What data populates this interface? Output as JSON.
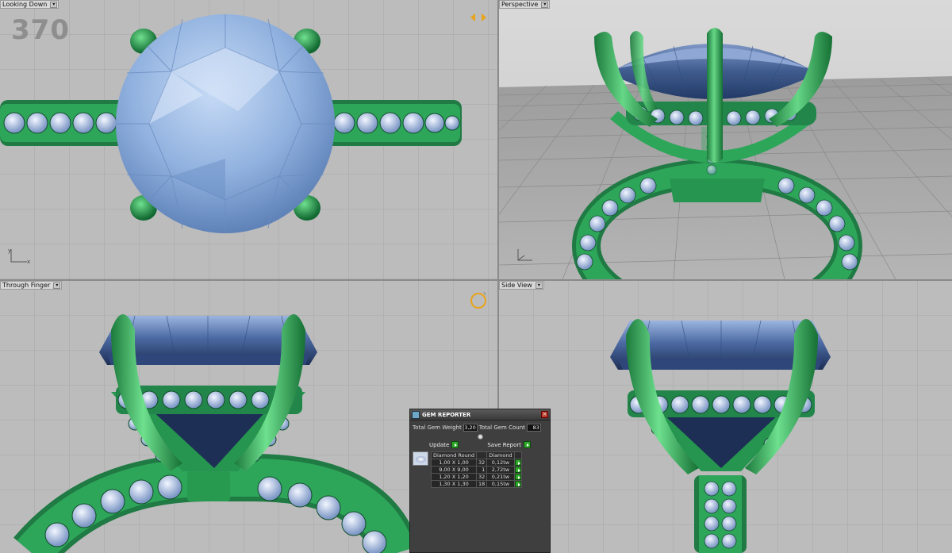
{
  "viewports": {
    "top_left": {
      "title": "Looking Down",
      "frame_counter": "370"
    },
    "top_right": {
      "title": "Perspective"
    },
    "bottom_left": {
      "title": "Through Finger"
    },
    "bottom_right": {
      "title": "Side View"
    }
  },
  "gem_reporter": {
    "title": "GEM REPORTER",
    "total_weight_label": "Total Gem Weight",
    "total_weight_value": "3,20",
    "total_count_label": "Total Gem Count",
    "total_count_value": "83",
    "update_label": "Update",
    "save_report_label": "Save Report",
    "table": {
      "headers": [
        "Diamond Round",
        "",
        "Diamond"
      ],
      "rows": [
        {
          "size": "1,00 X 1,00",
          "count": "32",
          "weight": "0,12tw"
        },
        {
          "size": "9,00 X 9,00",
          "count": "1",
          "weight": "2,72tw"
        },
        {
          "size": "1,20 X 1,20",
          "count": "32",
          "weight": "0,21tw"
        },
        {
          "size": "1,30 X 1,30",
          "count": "18",
          "weight": "0,15tw"
        }
      ]
    }
  },
  "colors": {
    "viewport_bg": "#bcbcbc",
    "grid_line": "#a6a6a6",
    "metal_green": "#2e9e53",
    "stone_blue": "#7fa7dc",
    "panel_bg": "#3f3f3f",
    "go_button": "#2fa82a"
  }
}
